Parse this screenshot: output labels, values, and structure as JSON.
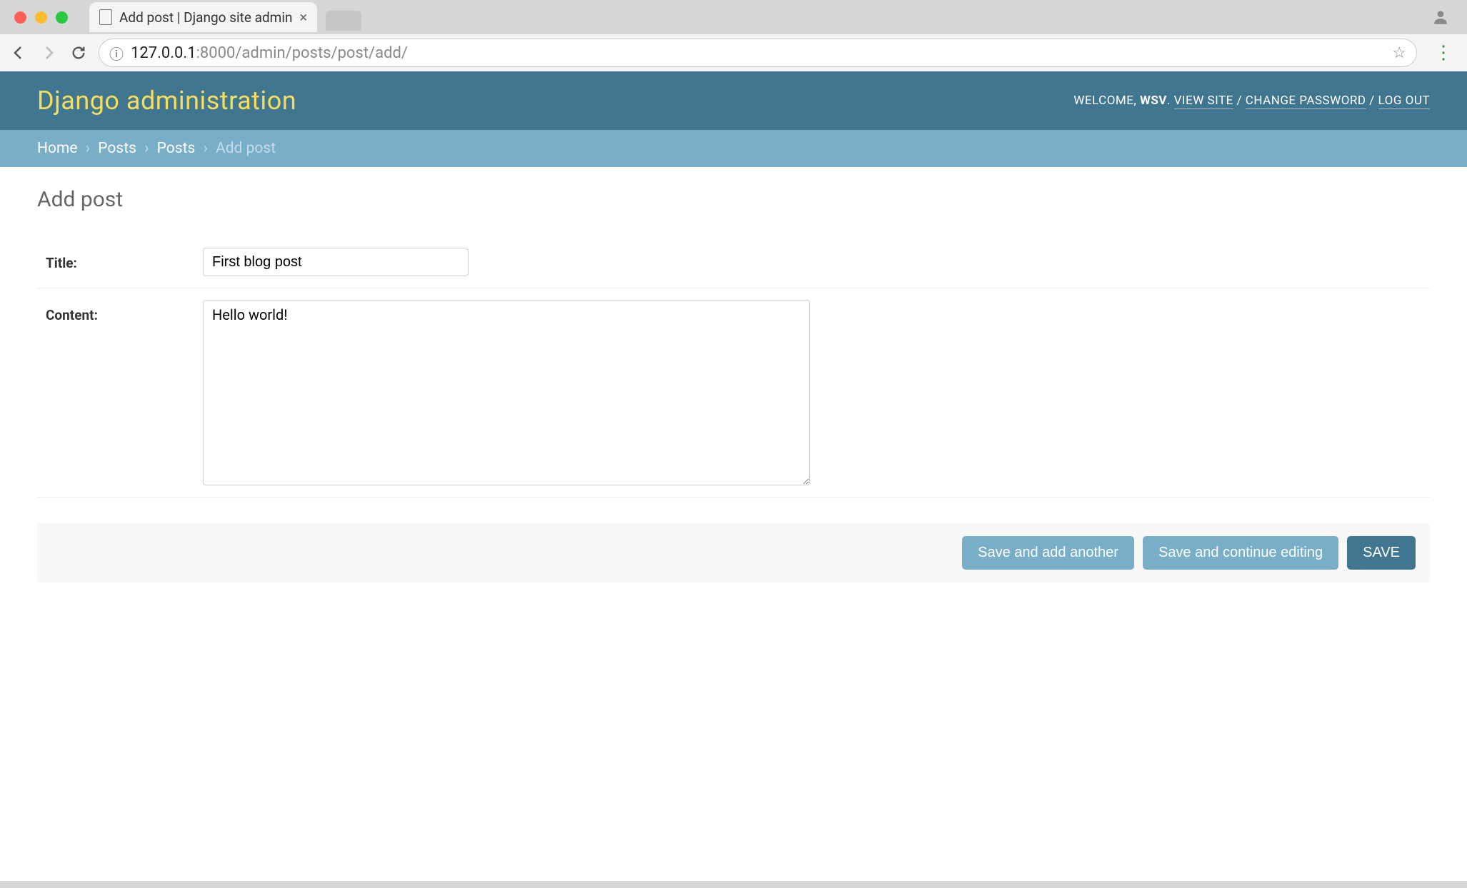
{
  "browser": {
    "tab_title": "Add post | Django site admin",
    "url_host": "127.0.0.1",
    "url_port_path": ":8000/admin/posts/post/add/"
  },
  "header": {
    "site_title": "Django administration",
    "welcome_text": "WELCOME, ",
    "username": "WSV",
    "view_site": "VIEW SITE",
    "change_password": "CHANGE PASSWORD",
    "logout": "LOG OUT",
    "sep_dot": ". ",
    "sep_slash": " / "
  },
  "breadcrumbs": {
    "home": "Home",
    "app": "Posts",
    "model": "Posts",
    "current": "Add post",
    "sep": "›"
  },
  "page": {
    "title": "Add post"
  },
  "form": {
    "title_label": "Title:",
    "title_value": "First blog post",
    "content_label": "Content:",
    "content_value": "Hello world!"
  },
  "buttons": {
    "save_add_another": "Save and add another",
    "save_continue": "Save and continue editing",
    "save": "SAVE"
  }
}
